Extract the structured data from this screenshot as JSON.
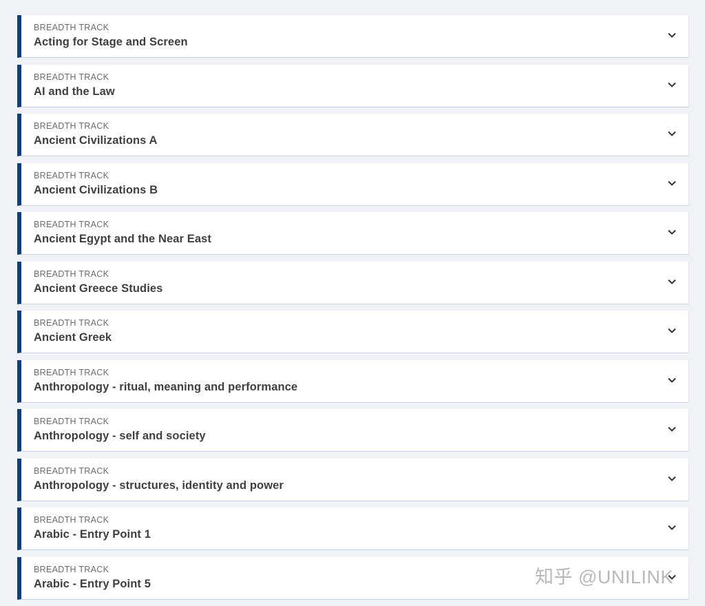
{
  "tracks": [
    {
      "label": "BREADTH TRACK",
      "title": "Acting for Stage and Screen"
    },
    {
      "label": "BREADTH TRACK",
      "title": "AI and the Law"
    },
    {
      "label": "BREADTH TRACK",
      "title": "Ancient Civilizations A"
    },
    {
      "label": "BREADTH TRACK",
      "title": "Ancient Civilizations B"
    },
    {
      "label": "BREADTH TRACK",
      "title": "Ancient Egypt and the Near East"
    },
    {
      "label": "BREADTH TRACK",
      "title": "Ancient Greece Studies"
    },
    {
      "label": "BREADTH TRACK",
      "title": "Ancient Greek"
    },
    {
      "label": "BREADTH TRACK",
      "title": "Anthropology - ritual, meaning and performance"
    },
    {
      "label": "BREADTH TRACK",
      "title": "Anthropology - self and society"
    },
    {
      "label": "BREADTH TRACK",
      "title": "Anthropology - structures, identity and power"
    },
    {
      "label": "BREADTH TRACK",
      "title": "Arabic - Entry Point 1"
    },
    {
      "label": "BREADTH TRACK",
      "title": "Arabic - Entry Point 5"
    }
  ],
  "expand_icon": "chevron-down-icon",
  "watermark": "知乎 @UNILINK",
  "colors": {
    "accent": "#0f3f7a",
    "background": "#eff3f8"
  }
}
